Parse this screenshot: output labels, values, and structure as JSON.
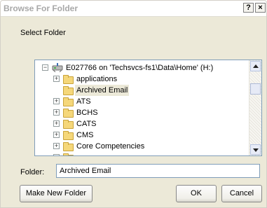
{
  "window": {
    "title": "Browse For Folder",
    "help_glyph": "?",
    "close_glyph": "×"
  },
  "prompt": "Select Folder",
  "tree": {
    "root": {
      "label": "E027766 on 'Techsvcs-fs1\\Data\\Home' (H:)",
      "icon": "network-drive-icon",
      "expanded": true
    },
    "items": [
      {
        "label": "applications",
        "expander": "+",
        "selected": false
      },
      {
        "label": "Archived Email",
        "expander": "",
        "selected": true
      },
      {
        "label": "ATS",
        "expander": "+",
        "selected": false
      },
      {
        "label": "BCHS",
        "expander": "+",
        "selected": false
      },
      {
        "label": "CATS",
        "expander": "+",
        "selected": false
      },
      {
        "label": "CMS",
        "expander": "+",
        "selected": false
      },
      {
        "label": "Core Competencies",
        "expander": "+",
        "selected": false
      }
    ]
  },
  "folder_field": {
    "label": "Folder:",
    "value": "Archived Email"
  },
  "buttons": {
    "make_new_folder": "Make New Folder",
    "ok": "OK",
    "cancel": "Cancel"
  },
  "colors": {
    "dialog_bg": "#ece9d8",
    "field_border": "#7f9db9",
    "folder_yellow": "#f5d77a"
  }
}
